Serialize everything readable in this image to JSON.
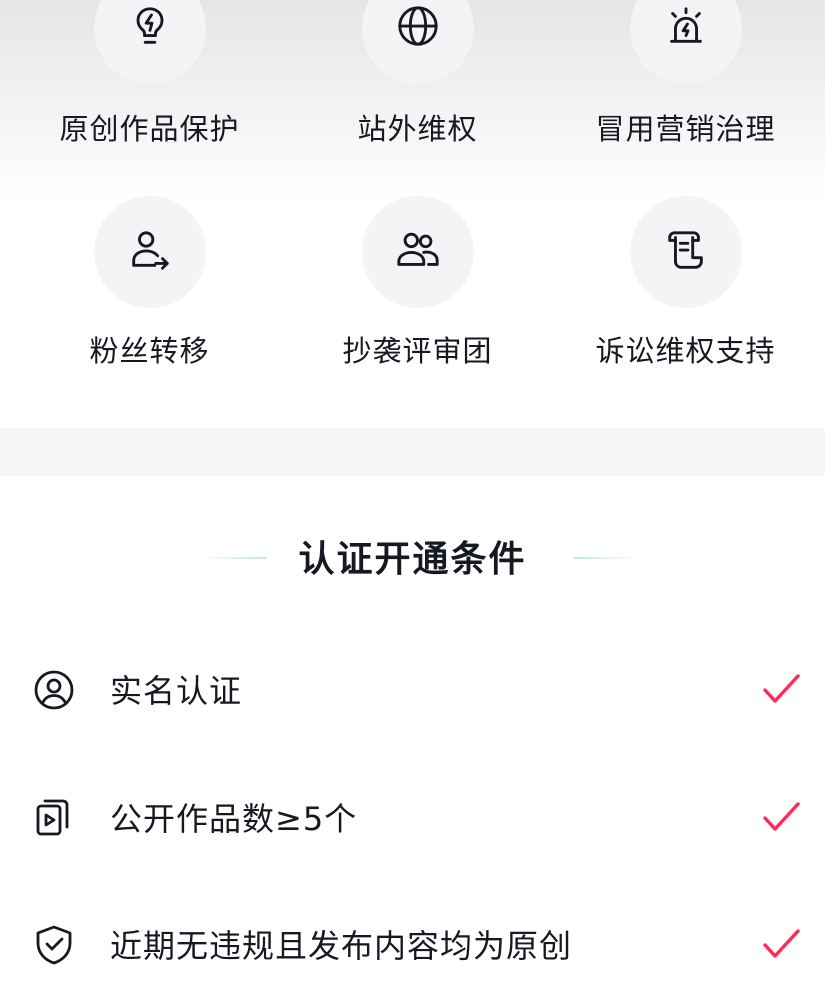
{
  "features": [
    {
      "label": "原创作品保护",
      "icon": "lightbulb-bolt-icon"
    },
    {
      "label": "站外维权",
      "icon": "globe-icon"
    },
    {
      "label": "冒用营销治理",
      "icon": "alarm-siren-icon"
    },
    {
      "label": "粉丝转移",
      "icon": "user-transfer-icon"
    },
    {
      "label": "抄袭评审团",
      "icon": "users-group-icon"
    },
    {
      "label": "诉讼维权支持",
      "icon": "scroll-document-icon"
    }
  ],
  "conditions_section": {
    "title": "认证开通条件",
    "items": [
      {
        "text": "实名认证",
        "icon": "user-circle-icon",
        "status": "check-icon"
      },
      {
        "text": "公开作品数≥5个",
        "icon": "video-card-icon",
        "status": "check-icon"
      },
      {
        "text": "近期无违规且发布内容均为原创",
        "icon": "shield-check-icon",
        "status": "check-icon"
      }
    ]
  },
  "colors": {
    "check": "#fe2c55",
    "text": "#161823",
    "icon_bg": "#f4f4f6",
    "title_line": "#bfe6e6"
  }
}
